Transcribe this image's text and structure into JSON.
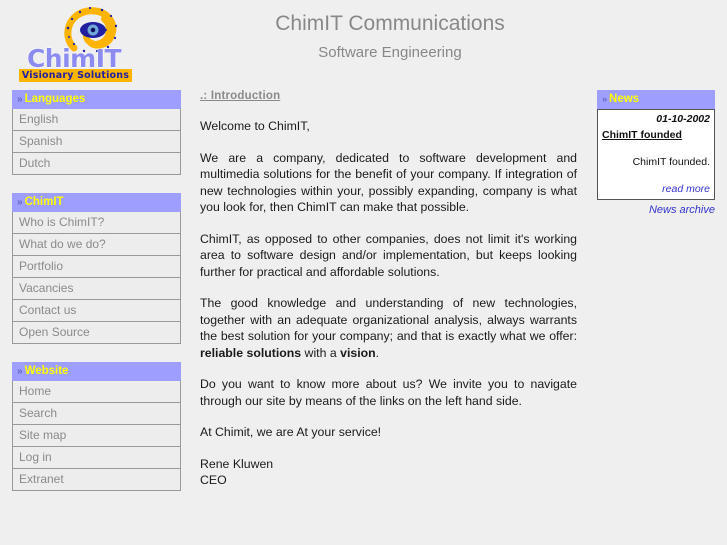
{
  "header": {
    "logo": {
      "wordmark": "ChimIT",
      "tagline": "Visionary Solutions",
      "swirl_icon": "swirl-eye-icon",
      "swirl_color": "#ffb400",
      "eye_color": "#2020a0",
      "wordmark_color": "#8c8cf0",
      "tagline_bg": "#ffb400"
    },
    "title": "ChimIT Communications",
    "subtitle": "Software Engineering"
  },
  "colors": {
    "page_bg": "#efefef",
    "panel_header_bg": "#9e9eff",
    "panel_header_text": "#ffff00",
    "nav_item_text": "#8a8a8a",
    "link": "#3333cc"
  },
  "sidebar": {
    "blocks": [
      {
        "header": "Languages",
        "marker": "»",
        "items": [
          {
            "label": "English"
          },
          {
            "label": "Spanish"
          },
          {
            "label": "Dutch"
          }
        ]
      },
      {
        "header": "ChimIT",
        "marker": "»",
        "items": [
          {
            "label": "Who is ChimIT?"
          },
          {
            "label": "What do we do?"
          },
          {
            "label": "Portfolio"
          },
          {
            "label": "Vacancies"
          },
          {
            "label": "Contact us"
          },
          {
            "label": "Open Source"
          }
        ]
      },
      {
        "header": "Website",
        "marker": "»",
        "items": [
          {
            "label": "Home"
          },
          {
            "label": "Search"
          },
          {
            "label": "Site map"
          },
          {
            "label": "Log in"
          },
          {
            "label": "Extranet"
          }
        ]
      }
    ]
  },
  "main": {
    "heading": ".: Introduction",
    "greeting": "Welcome to ChimIT,",
    "paragraph1": "We are a company, dedicated to software development and multimedia solutions for the benefit of your company. If integration of new technologies within your, possibly expanding, company is what you look for, then ChimIT can make that possible.",
    "paragraph2": "ChimIT, as opposed to other companies, does not limit it's working area to software design and/or implementation, but keeps looking further for practical and affordable solutions.",
    "paragraph3_part1": "The good knowledge and understanding of new technologies, together with an adequate organizational analysis, always warrants the best solution for your company; and that is exactly what we offer: ",
    "paragraph3_bold1": "reliable solutions",
    "paragraph3_part2": " with a ",
    "paragraph3_bold2": "vision",
    "paragraph3_part3": ".",
    "paragraph4": "Do you want to know more about us? We invite you to navigate through our site by means of the links on the left hand side.",
    "paragraph5": "At Chimit, we are At your service!",
    "signature_name": "Rene Kluwen",
    "signature_title": "CEO"
  },
  "news": {
    "header": "News",
    "marker": "»",
    "items": [
      {
        "date": "01-10-2002",
        "title": "ChimIT founded",
        "body": "ChimIT founded.",
        "read_more": "read more"
      }
    ],
    "archive_link": "News archive"
  }
}
